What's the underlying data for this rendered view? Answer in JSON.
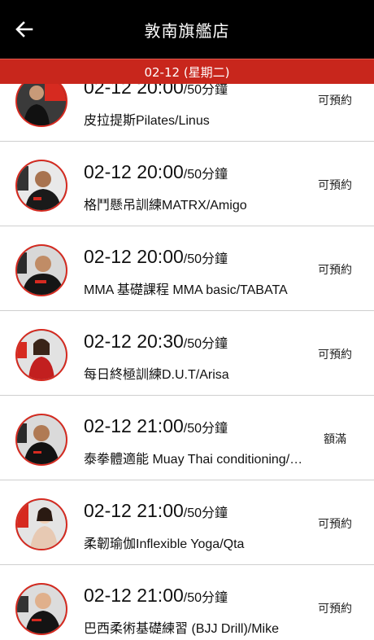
{
  "header": {
    "title": "敦南旗艦店",
    "back_icon": "arrow-left-icon"
  },
  "date_bar": {
    "label": "02-12 (星期二)"
  },
  "colors": {
    "header_bg": "#000000",
    "accent_red": "#c8261c"
  },
  "sessions": [
    {
      "time": "02-12 20:00",
      "duration": "/50分鐘",
      "class_name": "皮拉提斯Pilates/Linus",
      "status": "可預約"
    },
    {
      "time": "02-12 20:00",
      "duration": "/50分鐘",
      "class_name": "格鬥懸吊訓練MATRX/Amigo",
      "status": "可預約"
    },
    {
      "time": "02-12 20:00",
      "duration": "/50分鐘",
      "class_name": "MMA 基礎課程 MMA basic/TABATA",
      "status": "可預約"
    },
    {
      "time": "02-12 20:30",
      "duration": "/50分鐘",
      "class_name": "每日終極訓練D.U.T/Arisa",
      "status": "可預約"
    },
    {
      "time": "02-12 21:00",
      "duration": "/50分鐘",
      "class_name": "泰拳體適能 Muay Thai conditioning/Ray",
      "status": "額滿"
    },
    {
      "time": "02-12 21:00",
      "duration": "/50分鐘",
      "class_name": "柔韌瑜伽Inflexible Yoga/Qta",
      "status": "可預約"
    },
    {
      "time": "02-12 21:00",
      "duration": "/50分鐘",
      "class_name": "巴西柔術基礎練習 (BJJ Drill)/Mike",
      "status": "可預約"
    }
  ]
}
